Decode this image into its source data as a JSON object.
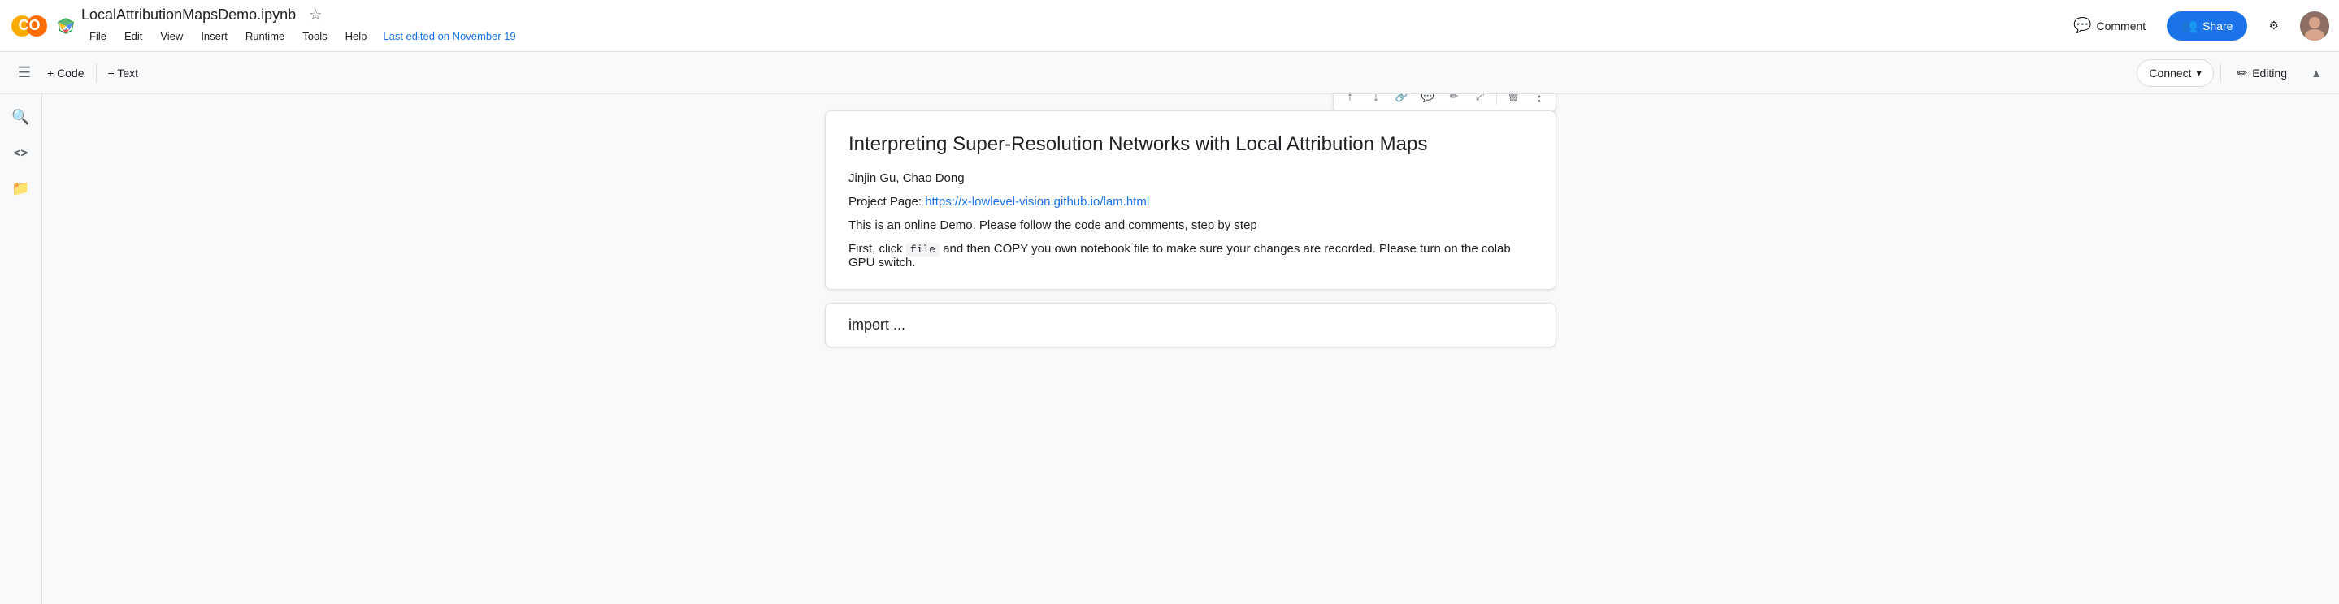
{
  "app": {
    "title": "LocalAttributionMapsDemo.ipynb"
  },
  "topbar": {
    "file_label": "File",
    "edit_label": "Edit",
    "view_label": "View",
    "insert_label": "Insert",
    "runtime_label": "Runtime",
    "tools_label": "Tools",
    "help_label": "Help",
    "last_edited": "Last edited on November 19",
    "comment_label": "Comment",
    "share_label": "Share",
    "settings_icon": "⚙"
  },
  "toolbar": {
    "add_code_label": "+ Code",
    "add_text_label": "+ Text",
    "connect_label": "Connect",
    "editing_label": "Editing",
    "chevron_up": "▲",
    "chevron_down_label": "▾"
  },
  "cell_toolbar": {
    "move_up": "↑",
    "move_down": "↓",
    "link": "🔗",
    "comment": "💬",
    "edit": "✏",
    "expand": "⤢",
    "delete": "🗑",
    "more": "⋮"
  },
  "cell": {
    "title": "Interpreting Super-Resolution Networks with Local Attribution Maps",
    "authors": "Jinjin Gu, Chao Dong",
    "project_label": "Project Page: ",
    "project_url": "https://x-lowlevel-vision.github.io/lam.html",
    "description": "This is an online Demo. Please follow the code and comments, step by step",
    "instruction_prefix": "First, click ",
    "instruction_code": "file",
    "instruction_suffix": " and then COPY you own notebook file to make sure your changes are recorded. Please turn on the colab GPU switch."
  },
  "next_cell": {
    "label": "import ..."
  },
  "sidebar": {
    "menu_icon": "☰",
    "search_icon": "🔍",
    "code_icon": "<>",
    "folder_icon": "📁"
  },
  "colors": {
    "blue": "#1a73e8",
    "text_dark": "#202124",
    "text_muted": "#5f6368",
    "border": "#e0e0e0",
    "bg_light": "#f8f9fa"
  }
}
